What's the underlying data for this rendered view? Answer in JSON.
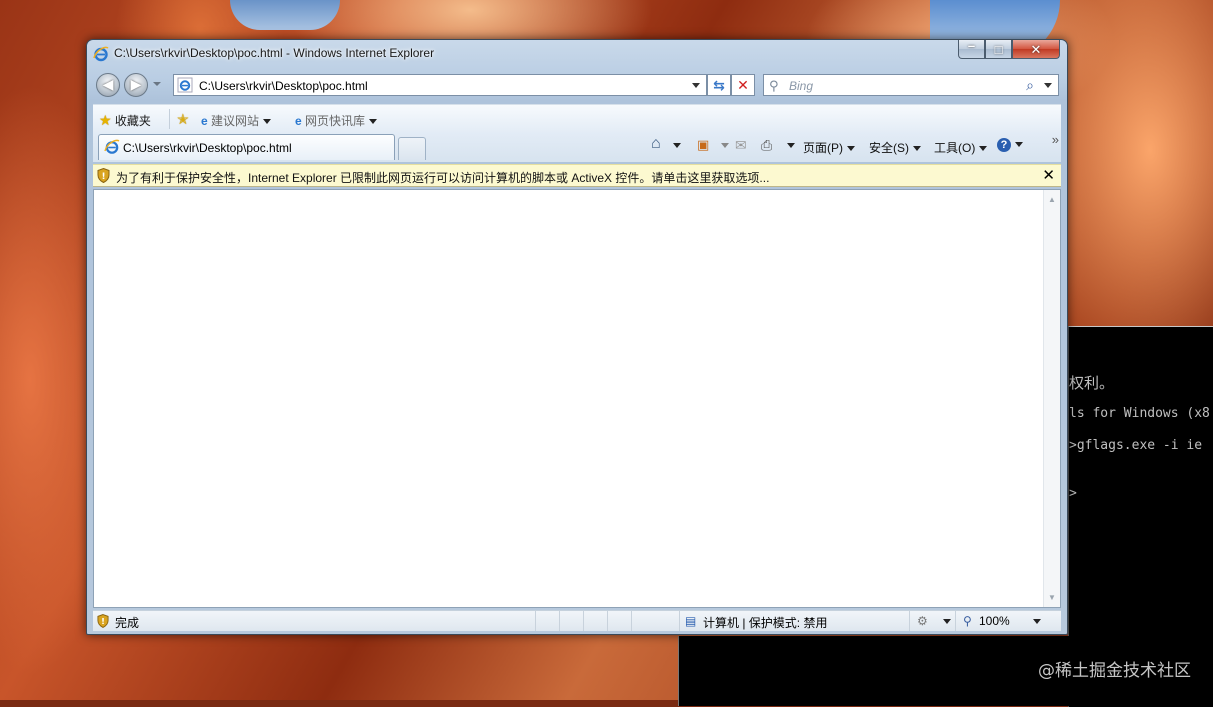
{
  "window": {
    "title": "C:\\Users\\rkvir\\Desktop\\poc.html - Windows Internet Explorer",
    "controls": {
      "minimize": "–",
      "maximize": "□",
      "close": "✕"
    }
  },
  "nav": {
    "back_glyph": "◀",
    "forward_glyph": "▶",
    "address": "C:\\Users\\rkvir\\Desktop\\poc.html",
    "refresh_glyph": "⇆",
    "stop_glyph": "✕",
    "search_placeholder": "Bing",
    "search_glyph": "⚲"
  },
  "favorites": {
    "favorites_label": "收藏夹",
    "suggested_sites": "建议网站",
    "web_slice_gallery": "网页快讯库"
  },
  "tab": {
    "label": "C:\\Users\\rkvir\\Desktop\\poc.html"
  },
  "commandbar": {
    "page": "页面(P)",
    "safety": "安全(S)",
    "tools": "工具(O)",
    "help_glyph": "?",
    "more": "»"
  },
  "infobar": {
    "message": "为了有利于保护安全性，Internet Explorer 已限制此网页运行可以访问计算机的脚本或 ActiveX 控件。请单击这里获取选项...",
    "close_glyph": "✕"
  },
  "status": {
    "done": "完成",
    "zone": "计算机 | 保护模式: 禁用",
    "zoom": "100%"
  },
  "console": {
    "lines": [
      "权利。",
      "ls for Windows (x8",
      ">gflags.exe -i ie",
      ">"
    ]
  },
  "watermark": "@稀土掘金技术社区"
}
